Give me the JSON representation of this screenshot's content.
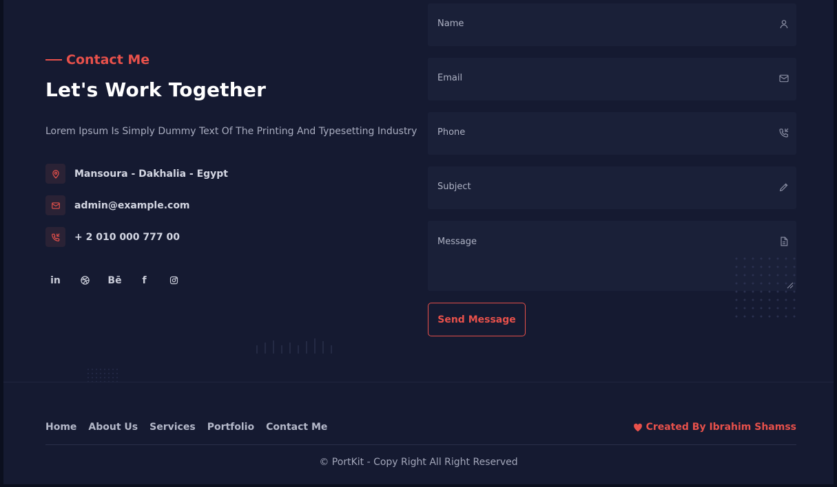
{
  "contact": {
    "eyebrow": "Contact Me",
    "headline": "Let's Work Together",
    "lead": "Lorem Ipsum Is Simply Dummy Text Of The Printing And Typesetting Industry",
    "info": [
      {
        "icon": "location-pin-icon",
        "text": "Mansoura - Dakhalia - Egypt"
      },
      {
        "icon": "mail-icon",
        "text": "admin@example.com"
      },
      {
        "icon": "phone-icon",
        "text": "+ 2 010 000 777 00"
      }
    ],
    "socials": [
      {
        "icon": "linkedin-icon",
        "glyph": "in"
      },
      {
        "icon": "dribbble-icon",
        "glyph": ""
      },
      {
        "icon": "behance-icon",
        "glyph": "Bē"
      },
      {
        "icon": "facebook-icon",
        "glyph": "f"
      },
      {
        "icon": "instagram-icon",
        "glyph": ""
      }
    ]
  },
  "form": {
    "name_label": "Name",
    "email_label": "Email",
    "phone_label": "Phone",
    "subject_label": "Subject",
    "message_label": "Message",
    "send_label": "Send Message"
  },
  "footer": {
    "nav": [
      "Home",
      "About Us",
      "Services",
      "Portfolio",
      "Contact Me"
    ],
    "credit": "Created By Ibrahim Shamss",
    "copyright": "© PortKit - Copy Right All Right Reserved"
  },
  "colors": {
    "accent": "#e8514b",
    "background": "#151a31",
    "field": "#1a2038"
  }
}
